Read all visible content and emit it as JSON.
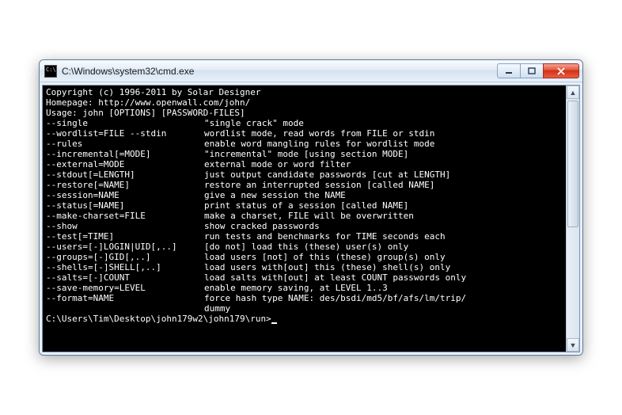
{
  "window": {
    "title": "C:\\Windows\\system32\\cmd.exe"
  },
  "header": {
    "copyright": "Copyright (c) 1996-2011 by Solar Designer",
    "homepage": "Homepage: http://www.openwall.com/john/"
  },
  "usage_line": "Usage: john [OPTIONS] [PASSWORD-FILES]",
  "options": [
    {
      "flag": "--single",
      "desc": "\"single crack\" mode"
    },
    {
      "flag": "--wordlist=FILE --stdin",
      "desc": "wordlist mode, read words from FILE or stdin"
    },
    {
      "flag": "--rules",
      "desc": "enable word mangling rules for wordlist mode"
    },
    {
      "flag": "--incremental[=MODE]",
      "desc": "\"incremental\" mode [using section MODE]"
    },
    {
      "flag": "--external=MODE",
      "desc": "external mode or word filter"
    },
    {
      "flag": "--stdout[=LENGTH]",
      "desc": "just output candidate passwords [cut at LENGTH]"
    },
    {
      "flag": "--restore[=NAME]",
      "desc": "restore an interrupted session [called NAME]"
    },
    {
      "flag": "--session=NAME",
      "desc": "give a new session the NAME"
    },
    {
      "flag": "--status[=NAME]",
      "desc": "print status of a session [called NAME]"
    },
    {
      "flag": "--make-charset=FILE",
      "desc": "make a charset, FILE will be overwritten"
    },
    {
      "flag": "--show",
      "desc": "show cracked passwords"
    },
    {
      "flag": "--test[=TIME]",
      "desc": "run tests and benchmarks for TIME seconds each"
    },
    {
      "flag": "--users=[-]LOGIN|UID[,..]",
      "desc": "[do not] load this (these) user(s) only"
    },
    {
      "flag": "--groups=[-]GID[,..]",
      "desc": "load users [not] of this (these) group(s) only"
    },
    {
      "flag": "--shells=[-]SHELL[,..]",
      "desc": "load users with[out] this (these) shell(s) only"
    },
    {
      "flag": "--salts=[-]COUNT",
      "desc": "load salts with[out] at least COUNT passwords only"
    },
    {
      "flag": "--save-memory=LEVEL",
      "desc": "enable memory saving, at LEVEL 1..3"
    },
    {
      "flag": "--format=NAME",
      "desc": "force hash type NAME: des/bsdi/md5/bf/afs/lm/trip/"
    },
    {
      "flag": "",
      "desc": "dummy"
    }
  ],
  "prompt": "C:\\Users\\Tim\\Desktop\\john179w2\\john179\\run>"
}
